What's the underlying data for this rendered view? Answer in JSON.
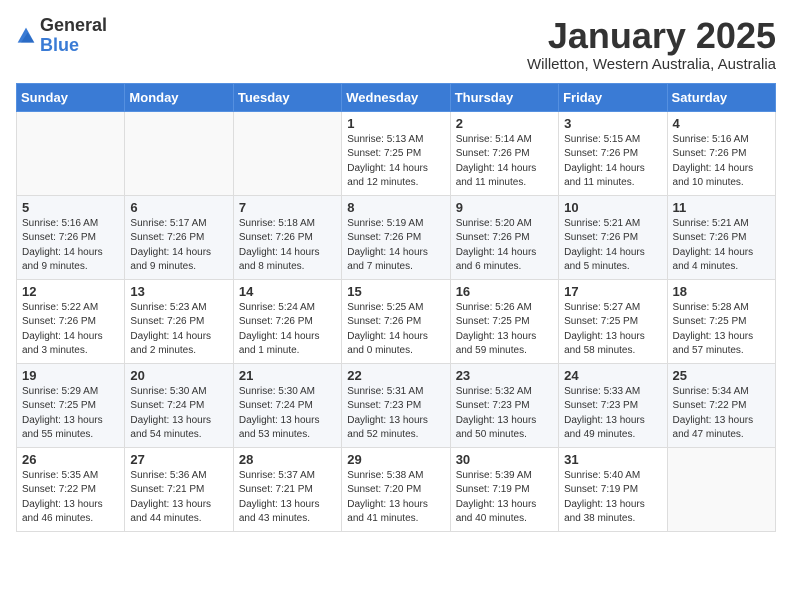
{
  "logo": {
    "general": "General",
    "blue": "Blue"
  },
  "header": {
    "title": "January 2025",
    "location": "Willetton, Western Australia, Australia"
  },
  "weekdays": [
    "Sunday",
    "Monday",
    "Tuesday",
    "Wednesday",
    "Thursday",
    "Friday",
    "Saturday"
  ],
  "weeks": [
    [
      {
        "day": "",
        "sunrise": "",
        "sunset": "",
        "daylight": ""
      },
      {
        "day": "",
        "sunrise": "",
        "sunset": "",
        "daylight": ""
      },
      {
        "day": "",
        "sunrise": "",
        "sunset": "",
        "daylight": ""
      },
      {
        "day": "1",
        "sunrise": "Sunrise: 5:13 AM",
        "sunset": "Sunset: 7:25 PM",
        "daylight": "Daylight: 14 hours and 12 minutes."
      },
      {
        "day": "2",
        "sunrise": "Sunrise: 5:14 AM",
        "sunset": "Sunset: 7:26 PM",
        "daylight": "Daylight: 14 hours and 11 minutes."
      },
      {
        "day": "3",
        "sunrise": "Sunrise: 5:15 AM",
        "sunset": "Sunset: 7:26 PM",
        "daylight": "Daylight: 14 hours and 11 minutes."
      },
      {
        "day": "4",
        "sunrise": "Sunrise: 5:16 AM",
        "sunset": "Sunset: 7:26 PM",
        "daylight": "Daylight: 14 hours and 10 minutes."
      }
    ],
    [
      {
        "day": "5",
        "sunrise": "Sunrise: 5:16 AM",
        "sunset": "Sunset: 7:26 PM",
        "daylight": "Daylight: 14 hours and 9 minutes."
      },
      {
        "day": "6",
        "sunrise": "Sunrise: 5:17 AM",
        "sunset": "Sunset: 7:26 PM",
        "daylight": "Daylight: 14 hours and 9 minutes."
      },
      {
        "day": "7",
        "sunrise": "Sunrise: 5:18 AM",
        "sunset": "Sunset: 7:26 PM",
        "daylight": "Daylight: 14 hours and 8 minutes."
      },
      {
        "day": "8",
        "sunrise": "Sunrise: 5:19 AM",
        "sunset": "Sunset: 7:26 PM",
        "daylight": "Daylight: 14 hours and 7 minutes."
      },
      {
        "day": "9",
        "sunrise": "Sunrise: 5:20 AM",
        "sunset": "Sunset: 7:26 PM",
        "daylight": "Daylight: 14 hours and 6 minutes."
      },
      {
        "day": "10",
        "sunrise": "Sunrise: 5:21 AM",
        "sunset": "Sunset: 7:26 PM",
        "daylight": "Daylight: 14 hours and 5 minutes."
      },
      {
        "day": "11",
        "sunrise": "Sunrise: 5:21 AM",
        "sunset": "Sunset: 7:26 PM",
        "daylight": "Daylight: 14 hours and 4 minutes."
      }
    ],
    [
      {
        "day": "12",
        "sunrise": "Sunrise: 5:22 AM",
        "sunset": "Sunset: 7:26 PM",
        "daylight": "Daylight: 14 hours and 3 minutes."
      },
      {
        "day": "13",
        "sunrise": "Sunrise: 5:23 AM",
        "sunset": "Sunset: 7:26 PM",
        "daylight": "Daylight: 14 hours and 2 minutes."
      },
      {
        "day": "14",
        "sunrise": "Sunrise: 5:24 AM",
        "sunset": "Sunset: 7:26 PM",
        "daylight": "Daylight: 14 hours and 1 minute."
      },
      {
        "day": "15",
        "sunrise": "Sunrise: 5:25 AM",
        "sunset": "Sunset: 7:26 PM",
        "daylight": "Daylight: 14 hours and 0 minutes."
      },
      {
        "day": "16",
        "sunrise": "Sunrise: 5:26 AM",
        "sunset": "Sunset: 7:25 PM",
        "daylight": "Daylight: 13 hours and 59 minutes."
      },
      {
        "day": "17",
        "sunrise": "Sunrise: 5:27 AM",
        "sunset": "Sunset: 7:25 PM",
        "daylight": "Daylight: 13 hours and 58 minutes."
      },
      {
        "day": "18",
        "sunrise": "Sunrise: 5:28 AM",
        "sunset": "Sunset: 7:25 PM",
        "daylight": "Daylight: 13 hours and 57 minutes."
      }
    ],
    [
      {
        "day": "19",
        "sunrise": "Sunrise: 5:29 AM",
        "sunset": "Sunset: 7:25 PM",
        "daylight": "Daylight: 13 hours and 55 minutes."
      },
      {
        "day": "20",
        "sunrise": "Sunrise: 5:30 AM",
        "sunset": "Sunset: 7:24 PM",
        "daylight": "Daylight: 13 hours and 54 minutes."
      },
      {
        "day": "21",
        "sunrise": "Sunrise: 5:30 AM",
        "sunset": "Sunset: 7:24 PM",
        "daylight": "Daylight: 13 hours and 53 minutes."
      },
      {
        "day": "22",
        "sunrise": "Sunrise: 5:31 AM",
        "sunset": "Sunset: 7:23 PM",
        "daylight": "Daylight: 13 hours and 52 minutes."
      },
      {
        "day": "23",
        "sunrise": "Sunrise: 5:32 AM",
        "sunset": "Sunset: 7:23 PM",
        "daylight": "Daylight: 13 hours and 50 minutes."
      },
      {
        "day": "24",
        "sunrise": "Sunrise: 5:33 AM",
        "sunset": "Sunset: 7:23 PM",
        "daylight": "Daylight: 13 hours and 49 minutes."
      },
      {
        "day": "25",
        "sunrise": "Sunrise: 5:34 AM",
        "sunset": "Sunset: 7:22 PM",
        "daylight": "Daylight: 13 hours and 47 minutes."
      }
    ],
    [
      {
        "day": "26",
        "sunrise": "Sunrise: 5:35 AM",
        "sunset": "Sunset: 7:22 PM",
        "daylight": "Daylight: 13 hours and 46 minutes."
      },
      {
        "day": "27",
        "sunrise": "Sunrise: 5:36 AM",
        "sunset": "Sunset: 7:21 PM",
        "daylight": "Daylight: 13 hours and 44 minutes."
      },
      {
        "day": "28",
        "sunrise": "Sunrise: 5:37 AM",
        "sunset": "Sunset: 7:21 PM",
        "daylight": "Daylight: 13 hours and 43 minutes."
      },
      {
        "day": "29",
        "sunrise": "Sunrise: 5:38 AM",
        "sunset": "Sunset: 7:20 PM",
        "daylight": "Daylight: 13 hours and 41 minutes."
      },
      {
        "day": "30",
        "sunrise": "Sunrise: 5:39 AM",
        "sunset": "Sunset: 7:19 PM",
        "daylight": "Daylight: 13 hours and 40 minutes."
      },
      {
        "day": "31",
        "sunrise": "Sunrise: 5:40 AM",
        "sunset": "Sunset: 7:19 PM",
        "daylight": "Daylight: 13 hours and 38 minutes."
      },
      {
        "day": "",
        "sunrise": "",
        "sunset": "",
        "daylight": ""
      }
    ]
  ]
}
